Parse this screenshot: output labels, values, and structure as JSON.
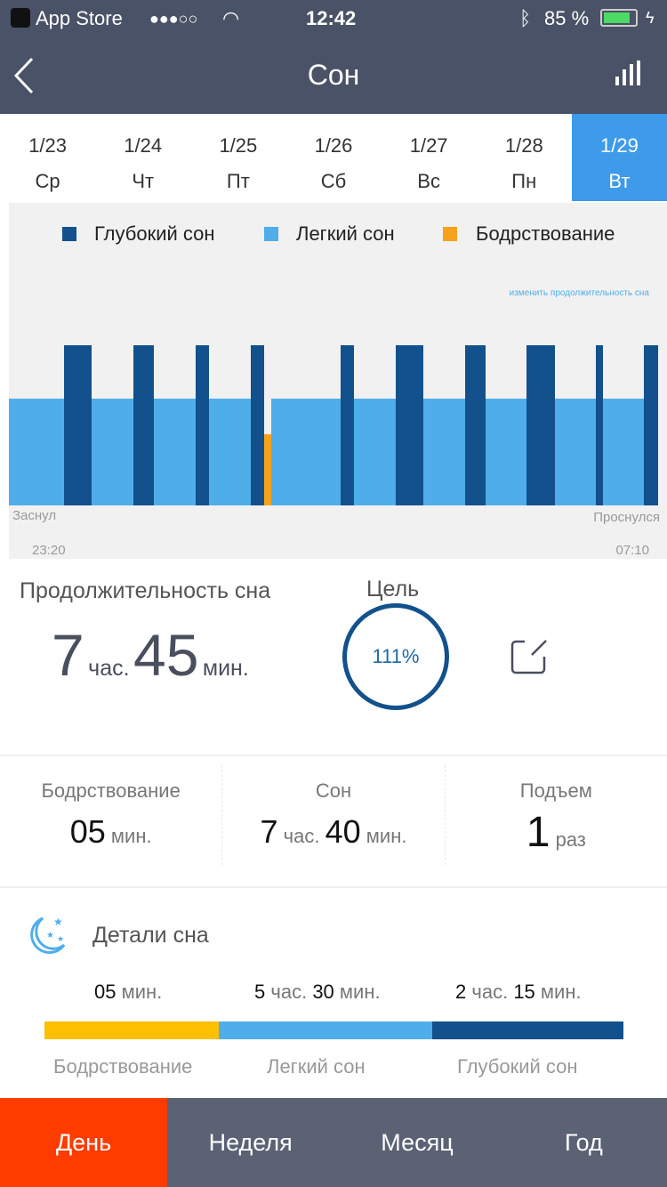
{
  "status_bar": {
    "back_app": "App Store",
    "signal": "●●●○○",
    "time": "12:42",
    "battery": "85 %"
  },
  "header": {
    "title": "Сон",
    "back_icon": "chevron-left-icon",
    "stats_icon": "bar-chart-icon"
  },
  "dates": [
    {
      "date": "1/23",
      "day": "Ср"
    },
    {
      "date": "1/24",
      "day": "Чт"
    },
    {
      "date": "1/25",
      "day": "Пт"
    },
    {
      "date": "1/26",
      "day": "Сб"
    },
    {
      "date": "1/27",
      "day": "Вс"
    },
    {
      "date": "1/28",
      "day": "Пн"
    },
    {
      "date": "1/29",
      "day": "Вт",
      "selected": true
    }
  ],
  "chart_data": {
    "type": "bar",
    "legend": [
      {
        "name": "Глубокий сон",
        "color": "#12518c"
      },
      {
        "name": "Легкий сон",
        "color": "#4faeea"
      },
      {
        "name": "Бодрствование",
        "color": "#f7a21b"
      }
    ],
    "link": "изменить продолжительность сна",
    "start_label": "Заснул",
    "end_label": "Проснулся",
    "start_time": "23:20",
    "end_time": "07:10",
    "segments": [
      [
        "light",
        "23:20",
        "00:00"
      ],
      [
        "deep",
        "00:00",
        "00:20"
      ],
      [
        "light",
        "00:20",
        "00:50"
      ],
      [
        "deep",
        "00:50",
        "01:05"
      ],
      [
        "light",
        "01:05",
        "01:35"
      ],
      [
        "deep",
        "01:35",
        "01:45"
      ],
      [
        "light",
        "01:45",
        "02:15"
      ],
      [
        "deep",
        "02:15",
        "02:25"
      ],
      [
        "awake",
        "02:25",
        "02:30"
      ],
      [
        "light",
        "02:30",
        "03:20"
      ],
      [
        "deep",
        "03:20",
        "03:30"
      ],
      [
        "light",
        "03:30",
        "04:00"
      ],
      [
        "deep",
        "04:00",
        "04:20"
      ],
      [
        "light",
        "04:20",
        "04:50"
      ],
      [
        "deep",
        "04:50",
        "05:05"
      ],
      [
        "light",
        "05:05",
        "05:35"
      ],
      [
        "deep",
        "05:35",
        "05:55"
      ],
      [
        "light",
        "05:55",
        "06:25"
      ],
      [
        "deep",
        "06:25",
        "06:30"
      ],
      [
        "light",
        "06:30",
        "07:00"
      ],
      [
        "deep",
        "07:00",
        "07:10"
      ]
    ]
  },
  "summary": {
    "title": "Продолжительность сна",
    "hours": "7",
    "hours_unit": "час.",
    "minutes": "45",
    "minutes_unit": "мин.",
    "goal_label": "Цель",
    "goal_percent": "111%",
    "edit_icon": "edit-icon"
  },
  "metrics": [
    {
      "label": "Бодрствование",
      "v1": "05",
      "u1": "мин."
    },
    {
      "label": "Сон",
      "v1": "7",
      "u1": "час.",
      "v2": "40",
      "u2": "мин."
    },
    {
      "label": "Подъем",
      "v1": "1",
      "u1": "раз"
    }
  ],
  "details": {
    "title": "Детали сна",
    "icon": "moon-stars-icon",
    "items": [
      {
        "v": "05",
        "u": "мин.",
        "label": "Бодрствование",
        "color": "#fdc000",
        "minutes": 5
      },
      {
        "v1": "5",
        "u1": "час.",
        "v2": "30",
        "u2": "мин.",
        "label": "Легкий сон",
        "color": "#4faeea",
        "minutes": 330
      },
      {
        "v1": "2",
        "u1": "час.",
        "v2": "15",
        "u2": "мин.",
        "label": "Глубокий сон",
        "color": "#12518c",
        "minutes": 135
      }
    ]
  },
  "tabs": [
    {
      "label": "День",
      "selected": true
    },
    {
      "label": "Неделя"
    },
    {
      "label": "Месяц"
    },
    {
      "label": "Год"
    }
  ]
}
